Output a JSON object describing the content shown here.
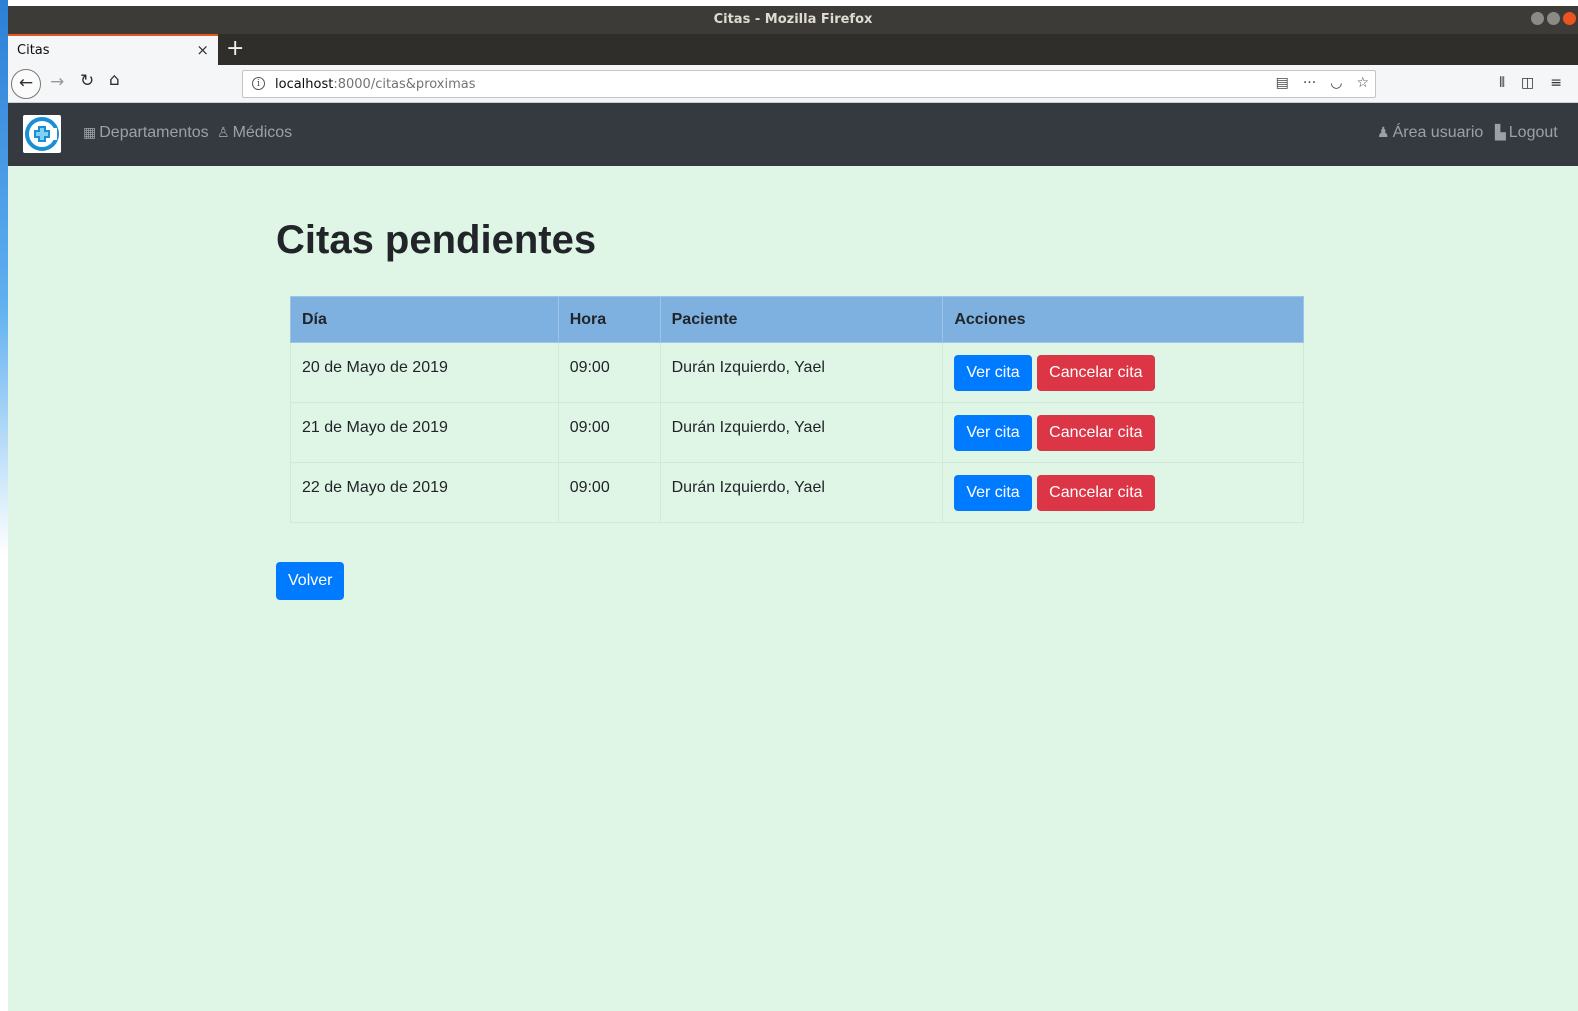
{
  "window": {
    "title": "Citas - Mozilla Firefox"
  },
  "browser": {
    "tab_title": "Citas",
    "tab_close": "×",
    "new_tab": "+",
    "url_host": "localhost",
    "url_rest": ":8000/citas&proximas"
  },
  "nav": {
    "departamentos": "Departamentos",
    "medicos": "Médicos",
    "area_usuario": "Área usuario",
    "logout": "Logout"
  },
  "main": {
    "title": "Citas pendientes",
    "headers": [
      "Día",
      "Hora",
      "Paciente",
      "Acciones"
    ],
    "rows": [
      {
        "dia": "20 de Mayo de 2019",
        "hora": "09:00",
        "paciente": "Durán Izquierdo, Yael",
        "ver": "Ver cita",
        "cancelar": "Cancelar cita"
      },
      {
        "dia": "21 de Mayo de 2019",
        "hora": "09:00",
        "paciente": "Durán Izquierdo, Yael",
        "ver": "Ver cita",
        "cancelar": "Cancelar cita"
      },
      {
        "dia": "22 de Mayo de 2019",
        "hora": "09:00",
        "paciente": "Durán Izquierdo, Yael",
        "ver": "Ver cita",
        "cancelar": "Cancelar cita"
      }
    ],
    "volver": "Volver"
  },
  "colors": {
    "page_bg": "#dff5e5",
    "navbar_bg": "#343a40",
    "table_header_bg": "#7fb1e0",
    "primary": "#007bff",
    "danger": "#dc3545"
  },
  "icons": {
    "logo": "medical-cross-logo",
    "departamentos": "building-icon",
    "medicos": "user-md-icon",
    "area_usuario": "user-icon",
    "logout": "door-exit-icon"
  }
}
